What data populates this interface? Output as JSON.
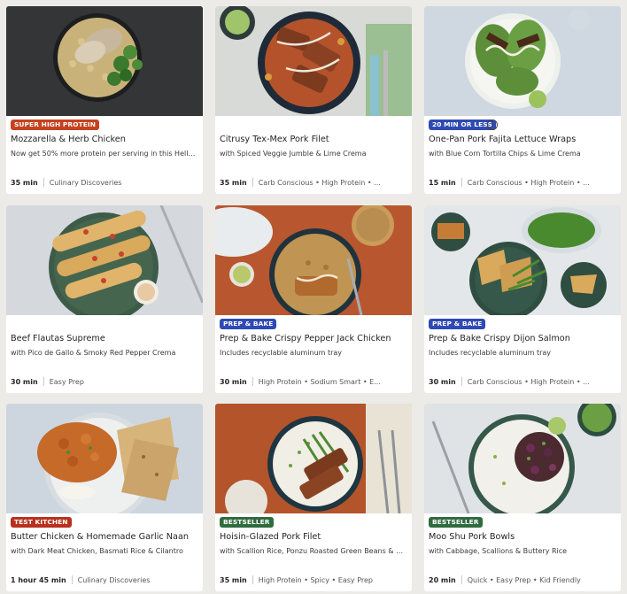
{
  "colors": {
    "badge_orange": "#c6411f",
    "badge_blue": "#2f4ab3",
    "badge_green": "#2f6b3e",
    "badge_red": "#b8301e"
  },
  "recipes": [
    {
      "badge": "SUPER HIGH PROTEIN",
      "badge_color": "#c6411f",
      "title": "Mozzarella & Herb Chicken",
      "subtitle": "Now get 50% more protein per serving in this HelloF...",
      "time": "35 min",
      "tags": "Culinary Discoveries",
      "photo_icon": "chicken-couscous-broccoli-bowl"
    },
    {
      "badge": "",
      "title": "Citrusy Tex-Mex Pork Filet",
      "subtitle": "with Spiced Veggie Jumble & Lime Crema",
      "time": "35 min",
      "tags": "Carb Conscious • High Protein • ...",
      "photo_icon": "pork-filet-plate"
    },
    {
      "badge": "20 MIN OR LESS",
      "badge_color": "#2f4ab3",
      "title": "One-Pan Pork Fajita Lettuce Wraps",
      "subtitle": "with Blue Corn Tortilla Chips & Lime Crema",
      "time": "15 min",
      "tags": "Carb Conscious • High Protein • ...",
      "photo_icon": "lettuce-wraps-plate"
    },
    {
      "badge": "",
      "title": "Beef Flautas Supreme",
      "subtitle": "with Pico de Gallo & Smoky Red Pepper Crema",
      "time": "30 min",
      "tags": "Easy Prep",
      "photo_icon": "flautas-plate"
    },
    {
      "badge": "PREP & BAKE",
      "badge_color": "#2f4ab3",
      "title": "Prep & Bake Crispy Pepper Jack Chicken",
      "subtitle": "Includes recyclable aluminum tray",
      "time": "30 min",
      "tags": "High Protein • Sodium Smart • E...",
      "photo_icon": "crispy-chicken-plate"
    },
    {
      "badge": "PREP & BAKE",
      "badge_color": "#2f4ab3",
      "title": "Prep & Bake Crispy Dijon Salmon",
      "subtitle": "Includes recyclable aluminum tray",
      "time": "30 min",
      "tags": "Carb Conscious • High Protein • ...",
      "photo_icon": "salmon-green-beans-plate"
    },
    {
      "badge": "TEST KITCHEN",
      "badge_color": "#b8301e",
      "title": "Butter Chicken & Homemade Garlic Naan",
      "subtitle": "with Dark Meat Chicken, Basmati Rice & Cilantro",
      "time": "1 hour 45 min",
      "tags": "Culinary Discoveries",
      "photo_icon": "butter-chicken-plate"
    },
    {
      "badge": "BESTSELLER",
      "badge_color": "#2f6b3e",
      "title": "Hoisin-Glazed Pork Filet",
      "subtitle": "with Scallion Rice, Ponzu Roasted Green Beans & Sr...",
      "time": "35 min",
      "tags": "High Protein • Spicy • Easy Prep",
      "photo_icon": "hoisin-pork-plate"
    },
    {
      "badge": "BESTSELLER",
      "badge_color": "#2f6b3e",
      "title": "Moo Shu Pork Bowls",
      "subtitle": "with Cabbage, Scallions & Buttery Rice",
      "time": "20 min",
      "tags": "Quick • Easy Prep • Kid Friendly",
      "photo_icon": "moo-shu-bowl"
    }
  ]
}
